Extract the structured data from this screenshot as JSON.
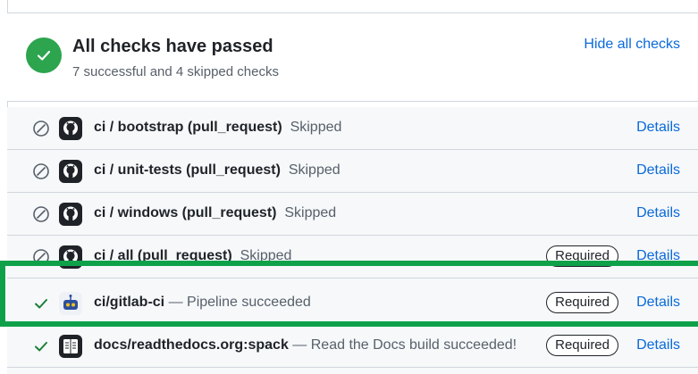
{
  "summary": {
    "title": "All checks have passed",
    "subtitle": "7 successful and 4 skipped checks",
    "hide_link": "Hide all checks",
    "status_color": "#2da44e"
  },
  "checks": [
    {
      "name": "ci / bootstrap (pull_request)",
      "desc": "Skipped",
      "status": "skipped",
      "app_icon": "github-icon",
      "required": "",
      "details": "Details"
    },
    {
      "name": "ci / unit-tests (pull_request)",
      "desc": "Skipped",
      "status": "skipped",
      "app_icon": "github-icon",
      "required": "",
      "details": "Details"
    },
    {
      "name": "ci / windows (pull_request)",
      "desc": "Skipped",
      "status": "skipped",
      "app_icon": "github-icon",
      "required": "",
      "details": "Details"
    },
    {
      "name": "ci / all (pull_request)",
      "desc": "Skipped",
      "status": "skipped",
      "app_icon": "github-icon",
      "required": "Required",
      "details": "Details"
    },
    {
      "name": "ci/gitlab-ci",
      "desc": "— Pipeline succeeded",
      "status": "success",
      "app_icon": "gitlab-bot-icon",
      "required": "Required",
      "details": "Details"
    },
    {
      "name": "docs/readthedocs.org:spack",
      "desc": "— Read the Docs build succeeded!",
      "status": "success",
      "app_icon": "readthedocs-icon",
      "required": "Required",
      "details": "Details"
    }
  ],
  "colors": {
    "link": "#0969da",
    "highlight_border": "#0fa14a",
    "success": "#1a7f37"
  }
}
